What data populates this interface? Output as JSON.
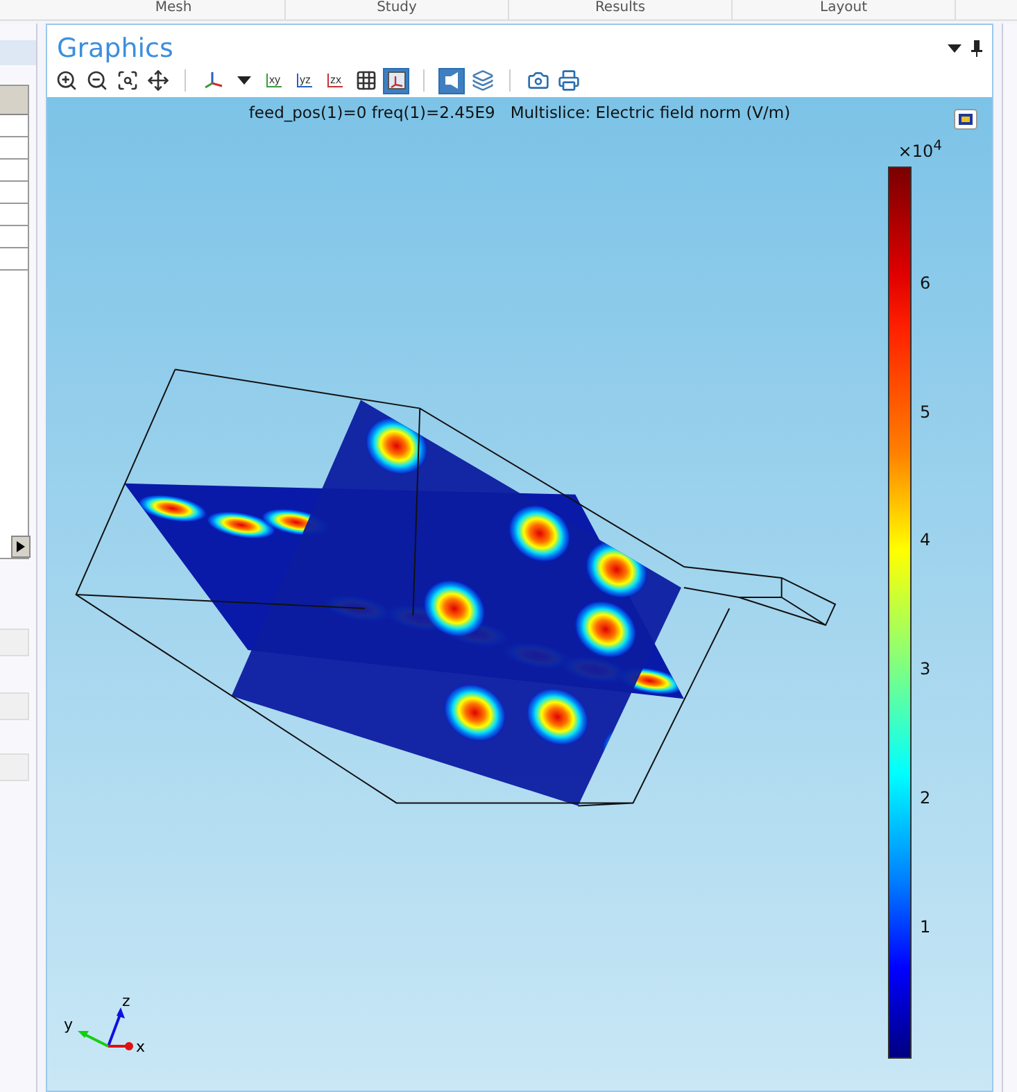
{
  "top_tabs": [
    "Mesh",
    "Study",
    "Results",
    "Layout"
  ],
  "graphics": {
    "title": "Graphics",
    "toolbar": [
      {
        "kind": "zoom_in",
        "selected": false
      },
      {
        "kind": "zoom_out",
        "selected": false
      },
      {
        "kind": "zoom_box",
        "selected": false
      },
      {
        "kind": "zoom_extents",
        "selected": false
      },
      {
        "kind": "separator"
      },
      {
        "kind": "axes",
        "selected": false
      },
      {
        "kind": "dropdown",
        "selected": false
      },
      {
        "kind": "view",
        "label": "xy",
        "color": "#3a9a3a",
        "selected": false
      },
      {
        "kind": "view",
        "label": "yz",
        "color": "#2a5fbf",
        "selected": false
      },
      {
        "kind": "view",
        "label": "zx",
        "color": "#c83030",
        "selected": false
      },
      {
        "kind": "grid",
        "selected": false
      },
      {
        "kind": "axis_view",
        "selected": true
      },
      {
        "kind": "separator"
      },
      {
        "kind": "scene_light",
        "selected": true
      },
      {
        "kind": "transparency",
        "selected": false
      },
      {
        "kind": "separator"
      },
      {
        "kind": "camera",
        "selected": false
      },
      {
        "kind": "print",
        "selected": false
      }
    ],
    "plot_title": "feed_pos(1)=0 freq(1)=2.45E9   Multislice: Electric field norm (V/m)",
    "colorbar": {
      "scale_label": "×10$^{4}$",
      "ticks": [
        "6",
        "5",
        "4",
        "3",
        "2",
        "1"
      ]
    },
    "triad": [
      "x",
      "y",
      "z"
    ]
  }
}
